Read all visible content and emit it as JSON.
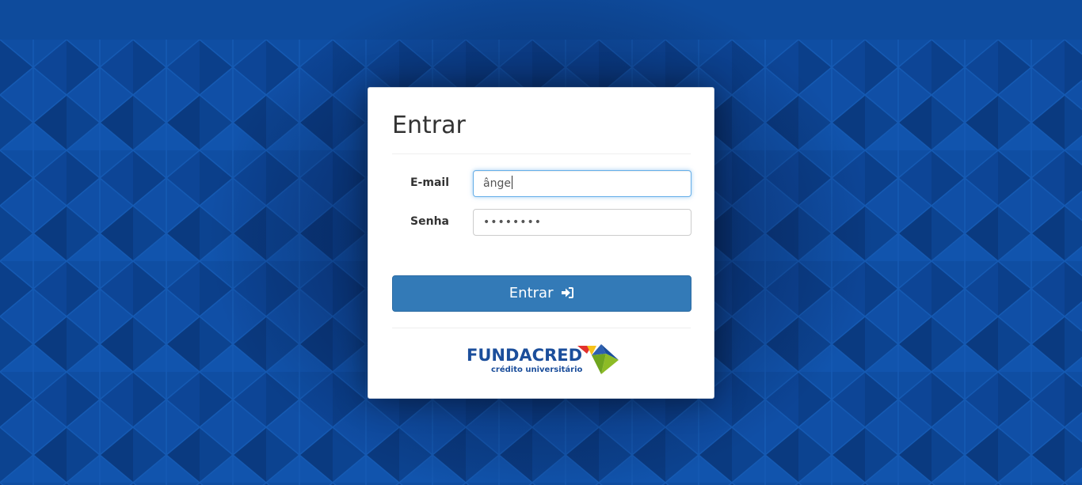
{
  "login": {
    "title": "Entrar",
    "email_label": "E-mail",
    "email_value": "ânge",
    "password_label": "Senha",
    "password_masked": "••••••••",
    "submit_label": "Entrar"
  },
  "brand": {
    "name": "FUNDACRED",
    "tagline": "crédito universitário"
  },
  "icons": {
    "submit": "sign-in-icon"
  },
  "colors": {
    "background": "#0f4a9b",
    "primary_button": "#337ab7",
    "brand_blue": "#1b4e9b",
    "logo_red": "#e2312d",
    "logo_yellow": "#f7c21a",
    "logo_green": "#8dbb26",
    "logo_blue": "#2d5fb0"
  }
}
